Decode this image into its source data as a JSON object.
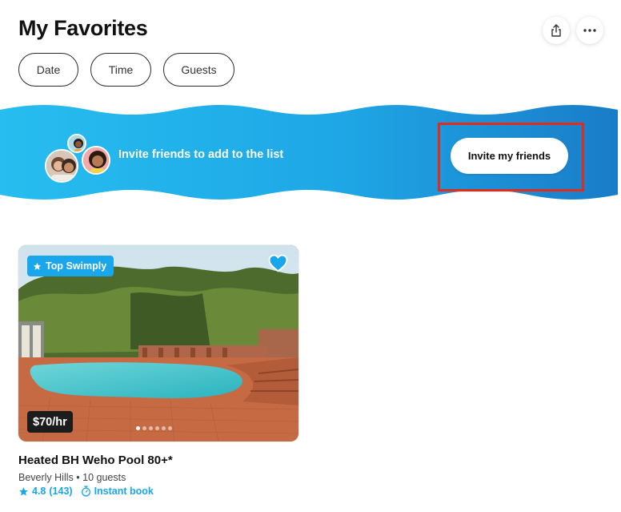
{
  "header": {
    "title": "My Favorites"
  },
  "actions": {
    "share_icon": "share-icon",
    "more_icon": "more-icon"
  },
  "filters": {
    "date": "Date",
    "time": "Time",
    "guests": "Guests"
  },
  "banner": {
    "text": "Invite friends to add to the list",
    "button_label": "Invite my friends",
    "color_start": "#25b7ec",
    "color_end": "#1976c4"
  },
  "listing": {
    "badge": "Top Swimply",
    "price": "$70/hr",
    "title": "Heated BH Weho Pool 80+*",
    "location": "Beverly Hills",
    "separator": "•",
    "guests": "10 guests",
    "rating": "4.8",
    "reviews": "(143)",
    "instant_book": "Instant book",
    "accent_color": "#1aa6ea"
  }
}
